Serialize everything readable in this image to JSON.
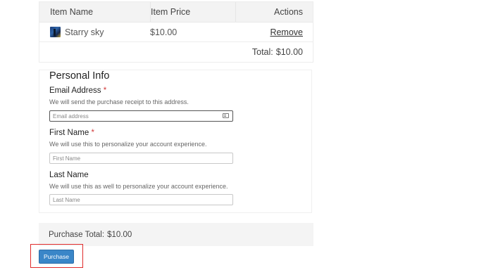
{
  "cart": {
    "headers": {
      "item_name": "Item Name",
      "item_price": "Item Price",
      "actions": "Actions"
    },
    "items": [
      {
        "thumbnail_icon": "starry-sky-thumbnail",
        "name": "Starry sky",
        "price": "$10.00",
        "action": "Remove"
      }
    ],
    "total_label": "Total:",
    "total_value": "$10.00"
  },
  "personal_info": {
    "title": "Personal Info",
    "email": {
      "label": "Email Address",
      "required_mark": "*",
      "help": "We will send the purchase receipt to this address.",
      "placeholder": "Email address",
      "value": "",
      "icon": "card-icon"
    },
    "first_name": {
      "label": "First Name",
      "required_mark": "*",
      "help": "We will use this to personalize your account experience.",
      "placeholder": "First Name",
      "value": ""
    },
    "last_name": {
      "label": "Last Name",
      "help": "We will use this as well to personalize your account experience.",
      "placeholder": "Last Name",
      "value": ""
    }
  },
  "purchase_total": {
    "label": "Purchase Total:",
    "value": "$10.00"
  },
  "purchase_button": {
    "label": "Purchase"
  },
  "colors": {
    "button_bg": "#3a86c8",
    "required": "#d23a3a",
    "highlight": "#e02b2b"
  }
}
